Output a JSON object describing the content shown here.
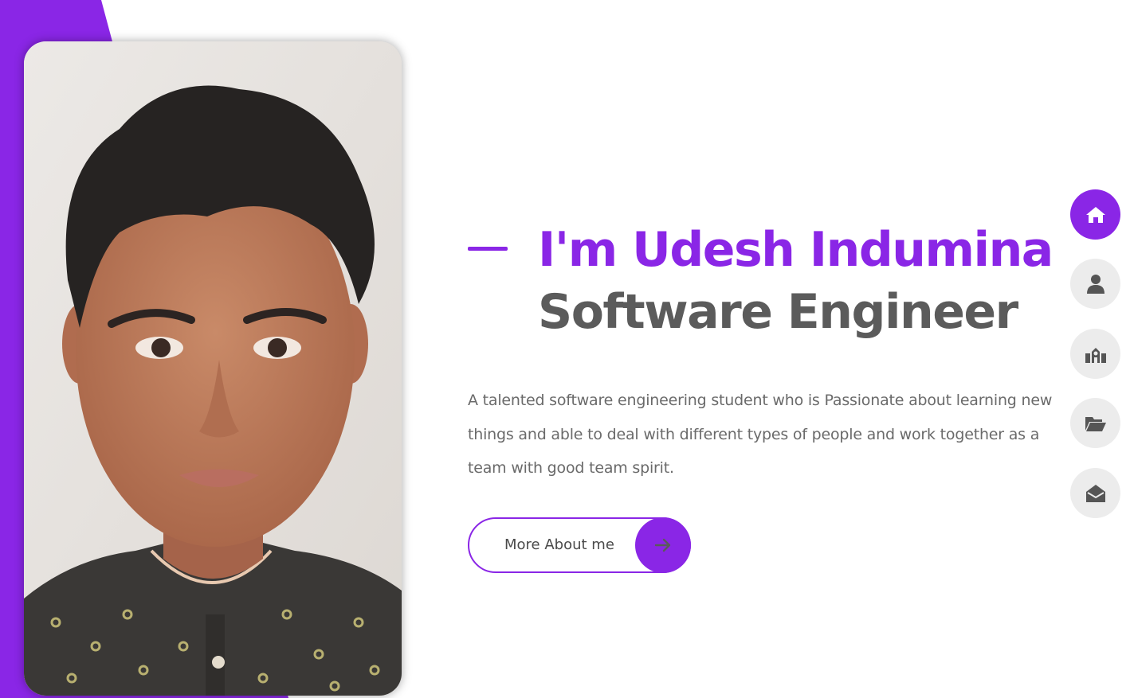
{
  "hero": {
    "greeting": "I'm Udesh Indumina",
    "role": "Software Engineer",
    "bio": "A talented software engineering student who is Passionate about learning new things and able to deal with different types of people and work together as a team with good team spirit.",
    "cta_label": "More About me"
  },
  "side_nav": [
    {
      "name": "home",
      "icon": "home-icon",
      "active": true
    },
    {
      "name": "about",
      "icon": "user-icon",
      "active": false
    },
    {
      "name": "education",
      "icon": "school-icon",
      "active": false
    },
    {
      "name": "portfolio",
      "icon": "folder-open-icon",
      "active": false
    },
    {
      "name": "contact",
      "icon": "envelope-open-icon",
      "active": false
    }
  ],
  "colors": {
    "accent": "#8a26e6",
    "heading_gray": "#5b5b5b",
    "body_gray": "#6a6a6a",
    "nav_inactive": "#ececec",
    "icon_gray": "#555555"
  }
}
